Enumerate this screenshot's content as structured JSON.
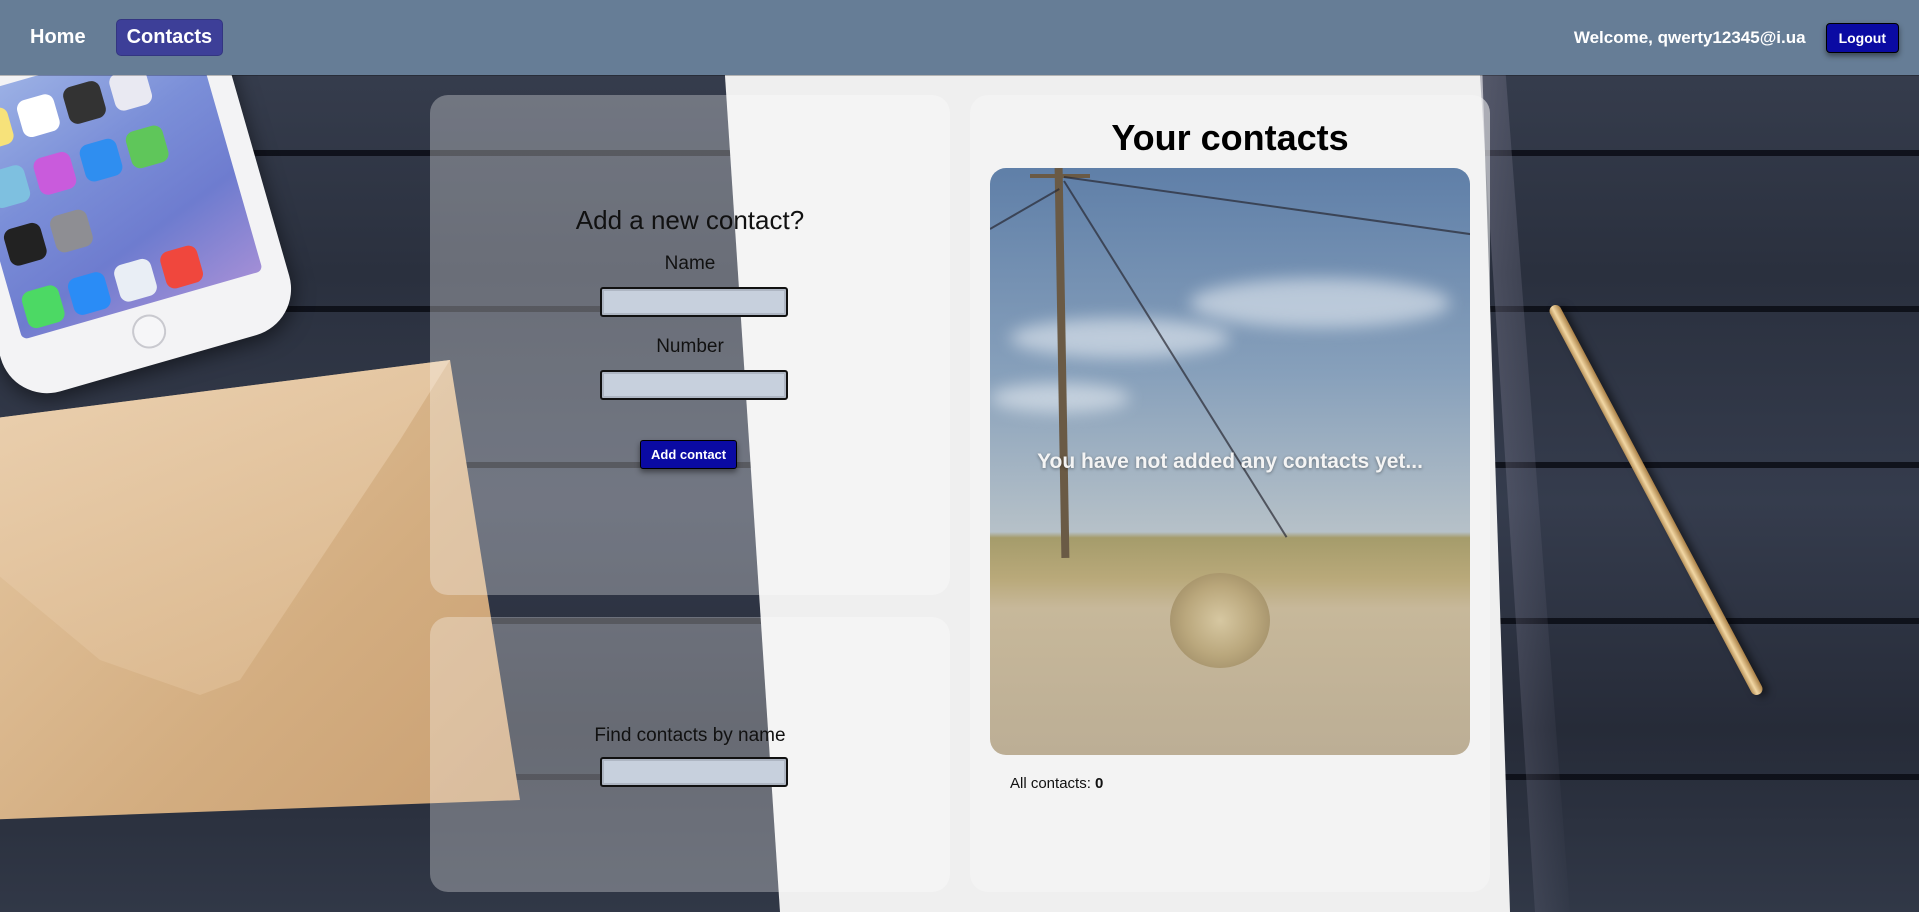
{
  "nav": {
    "home_label": "Home",
    "contacts_label": "Contacts",
    "welcome_prefix": "Welcome,",
    "user_email": "qwerty12345@i.ua",
    "logout_label": "Logout"
  },
  "add_form": {
    "title": "Add a new contact?",
    "name_label": "Name",
    "name_value": "",
    "number_label": "Number",
    "number_value": "",
    "submit_label": "Add contact"
  },
  "find_form": {
    "label": "Find contacts by name",
    "value": ""
  },
  "contacts": {
    "title": "Your contacts",
    "empty_message": "You have not added any contacts yet...",
    "count_label": "All contacts:",
    "count_value": "0"
  },
  "colors": {
    "navbar": "#667d96",
    "accent_button": "#0a0aa3",
    "active_nav": "#3d3f98"
  }
}
